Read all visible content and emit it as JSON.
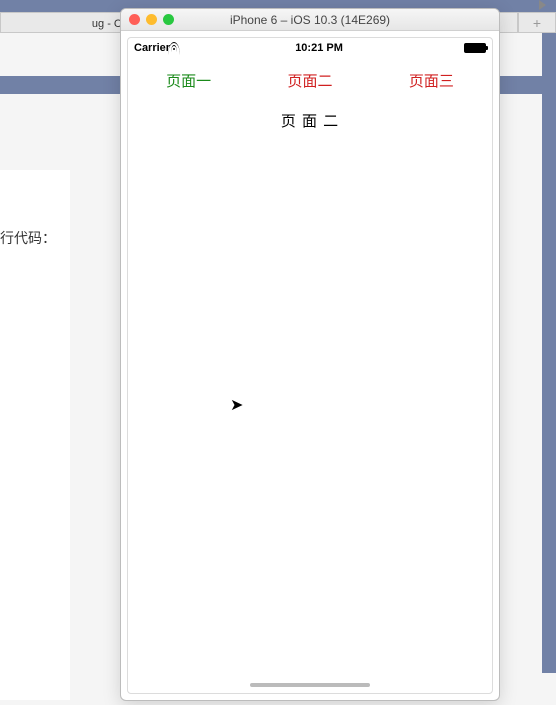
{
  "browser": {
    "tab_partial": "ug - CSDN博客",
    "add_tab": "+"
  },
  "simulator": {
    "title": "iPhone 6 – iOS 10.3 (14E269)"
  },
  "status_bar": {
    "carrier": "Carrier",
    "time": "10:21 PM"
  },
  "tabs": [
    {
      "label": "页面一",
      "active": true
    },
    {
      "label": "页面二",
      "active": false
    },
    {
      "label": "页面三",
      "active": false
    }
  ],
  "page": {
    "content": "页 面 二"
  },
  "bg_text": "行代码："
}
